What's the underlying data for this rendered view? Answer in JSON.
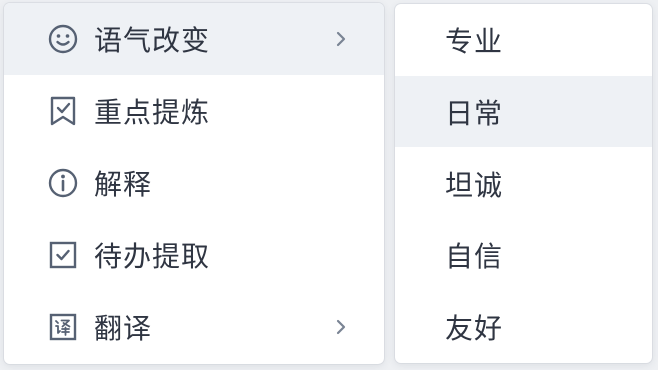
{
  "main_menu": {
    "items": [
      {
        "label": "语气改变",
        "icon": "smiley-icon",
        "has_submenu": true,
        "active": true
      },
      {
        "label": "重点提炼",
        "icon": "bookmark-check-icon",
        "has_submenu": false,
        "active": false
      },
      {
        "label": "解释",
        "icon": "info-icon",
        "has_submenu": false,
        "active": false
      },
      {
        "label": "待办提取",
        "icon": "checkbox-icon",
        "has_submenu": false,
        "active": false
      },
      {
        "label": "翻译",
        "icon": "translate-icon",
        "has_submenu": true,
        "active": false
      }
    ]
  },
  "sub_menu": {
    "items": [
      {
        "label": "专业",
        "active": false
      },
      {
        "label": "日常",
        "active": true
      },
      {
        "label": "坦诚",
        "active": false
      },
      {
        "label": "自信",
        "active": false
      },
      {
        "label": "友好",
        "active": false
      }
    ]
  },
  "colors": {
    "text": "#2f3542",
    "icon": "#566173",
    "hover_bg": "#eef1f5",
    "page_bg": "#eef0f3",
    "menu_bg": "#ffffff"
  }
}
